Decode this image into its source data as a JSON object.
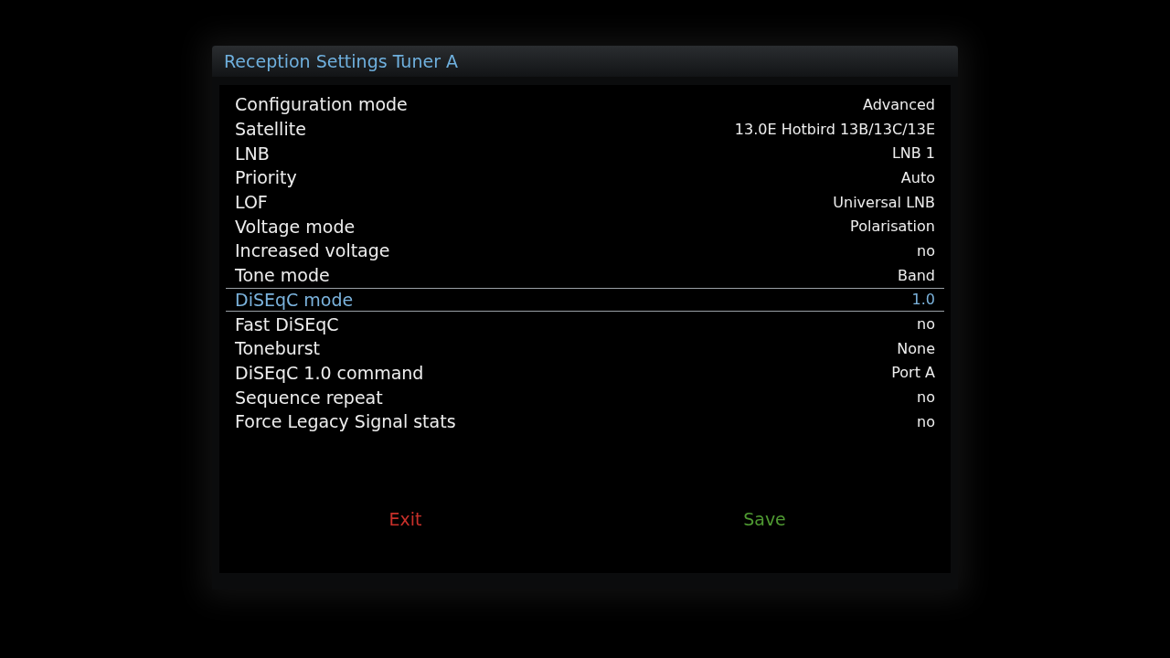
{
  "window": {
    "title": "Reception Settings Tuner A"
  },
  "settings": [
    {
      "label": "Configuration mode",
      "value": "Advanced",
      "selected": false
    },
    {
      "label": "Satellite",
      "value": "13.0E Hotbird 13B/13C/13E",
      "selected": false
    },
    {
      "label": "LNB",
      "value": "LNB 1",
      "selected": false
    },
    {
      "label": "Priority",
      "value": "Auto",
      "selected": false
    },
    {
      "label": "LOF",
      "value": "Universal LNB",
      "selected": false
    },
    {
      "label": "Voltage mode",
      "value": "Polarisation",
      "selected": false
    },
    {
      "label": "Increased voltage",
      "value": "no",
      "selected": false
    },
    {
      "label": "Tone mode",
      "value": "Band",
      "selected": false
    },
    {
      "label": "DiSEqC mode",
      "value": "1.0",
      "selected": true
    },
    {
      "label": "Fast DiSEqC",
      "value": "no",
      "selected": false
    },
    {
      "label": "Toneburst",
      "value": "None",
      "selected": false
    },
    {
      "label": "DiSEqC 1.0 command",
      "value": "Port A",
      "selected": false
    },
    {
      "label": "Sequence repeat",
      "value": "no",
      "selected": false
    },
    {
      "label": "Force Legacy Signal stats",
      "value": "no",
      "selected": false
    }
  ],
  "buttons": [
    {
      "label": "Exit",
      "kind": "red"
    },
    {
      "label": "Save",
      "kind": "green"
    }
  ]
}
